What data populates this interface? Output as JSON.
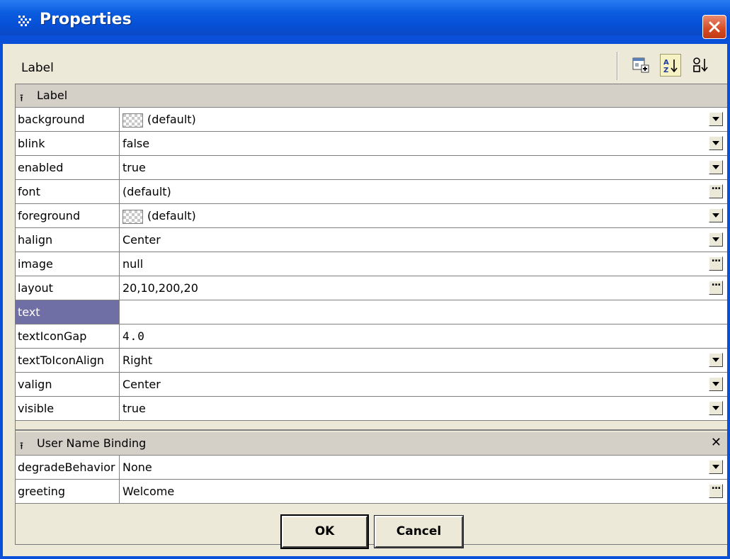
{
  "window": {
    "title": "Properties",
    "title_icon": "properties-icon",
    "close_icon": "close-icon"
  },
  "toolbar": {
    "label": "Label",
    "buttons": [
      {
        "name": "add-icon"
      },
      {
        "name": "sort-alpha-icon",
        "pressed": true
      },
      {
        "name": "sort-order-icon"
      }
    ]
  },
  "groups": [
    {
      "title": "Label",
      "rows": [
        {
          "name": "background",
          "value": "(default)",
          "swatch": true,
          "control": "dropdown"
        },
        {
          "name": "blink",
          "value": "false",
          "control": "dropdown"
        },
        {
          "name": "enabled",
          "value": "true",
          "control": "dropdown"
        },
        {
          "name": "font",
          "value": "(default)",
          "control": "ellipsis"
        },
        {
          "name": "foreground",
          "value": "(default)",
          "swatch": true,
          "control": "dropdown"
        },
        {
          "name": "halign",
          "value": "Center",
          "control": "dropdown"
        },
        {
          "name": "image",
          "value": "null",
          "control": "ellipsis"
        },
        {
          "name": "layout",
          "value": "20,10,200,20",
          "control": "ellipsis"
        },
        {
          "name": "text",
          "value": "",
          "selected": true
        },
        {
          "name": "textIconGap",
          "value": "4.0",
          "mono": true
        },
        {
          "name": "textToIconAlign",
          "value": "Right",
          "control": "dropdown"
        },
        {
          "name": "valign",
          "value": "Center",
          "control": "dropdown"
        },
        {
          "name": "visible",
          "value": "true",
          "control": "dropdown"
        }
      ]
    },
    {
      "title": "User Name Binding",
      "removable": true,
      "rows": [
        {
          "name": "degradeBehavior",
          "value": "None",
          "control": "dropdown"
        },
        {
          "name": "greeting",
          "value": "Welcome",
          "control": "ellipsis"
        }
      ]
    }
  ],
  "buttons": {
    "ok": "OK",
    "cancel": "Cancel"
  },
  "colors": {
    "titlebar": "#0a5ae0",
    "selection": "#6f6fa5",
    "face": "#ece9d8"
  }
}
